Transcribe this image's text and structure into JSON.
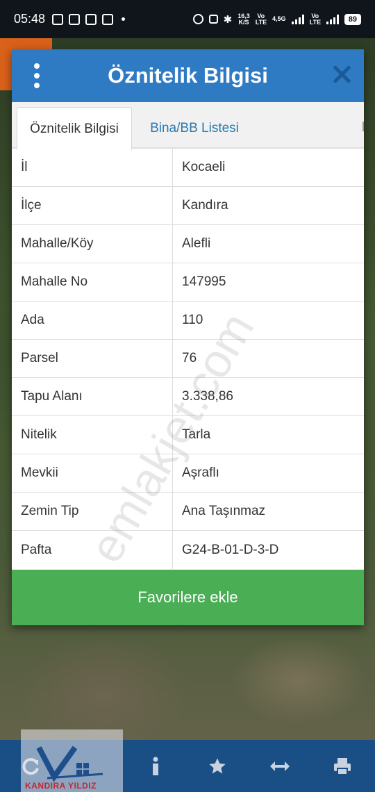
{
  "status_bar": {
    "time": "05:48",
    "net_speed": "16,3",
    "net_unit": "K/S",
    "lte1": "Vo LTE",
    "lte2": "4,5G",
    "lte3": "Vo LTE",
    "battery": "89"
  },
  "dialog": {
    "title": "Öznitelik Bilgisi",
    "tabs": [
      {
        "label": "Öznitelik Bilgisi"
      },
      {
        "label": "Bina/BB Listesi"
      }
    ],
    "rows": [
      {
        "key": "İl",
        "value": "Kocaeli"
      },
      {
        "key": "İlçe",
        "value": "Kandıra"
      },
      {
        "key": "Mahalle/Köy",
        "value": "Alefli"
      },
      {
        "key": "Mahalle No",
        "value": "147995"
      },
      {
        "key": "Ada",
        "value": "110"
      },
      {
        "key": "Parsel",
        "value": "76"
      },
      {
        "key": "Tapu Alanı",
        "value": "3.338,86"
      },
      {
        "key": "Nitelik",
        "value": "Tarla"
      },
      {
        "key": "Mevkii",
        "value": "Aşraflı"
      },
      {
        "key": "Zemin Tip",
        "value": "Ana Taşınmaz"
      },
      {
        "key": "Pafta",
        "value": "G24-B-01-D-3-D"
      }
    ],
    "favorite_label": "Favorilere ekle"
  },
  "watermark": "emlakjet.com",
  "logo_text": "KANDIRA YILDIZ",
  "toolbar": {
    "icons": [
      "refresh-icon",
      "info-icon",
      "star-icon",
      "arrows-icon",
      "print-icon"
    ]
  },
  "colors": {
    "header_blue": "#2e7bc4",
    "favorite_green": "#4aae55",
    "toolbar_blue": "#1a4f86"
  }
}
